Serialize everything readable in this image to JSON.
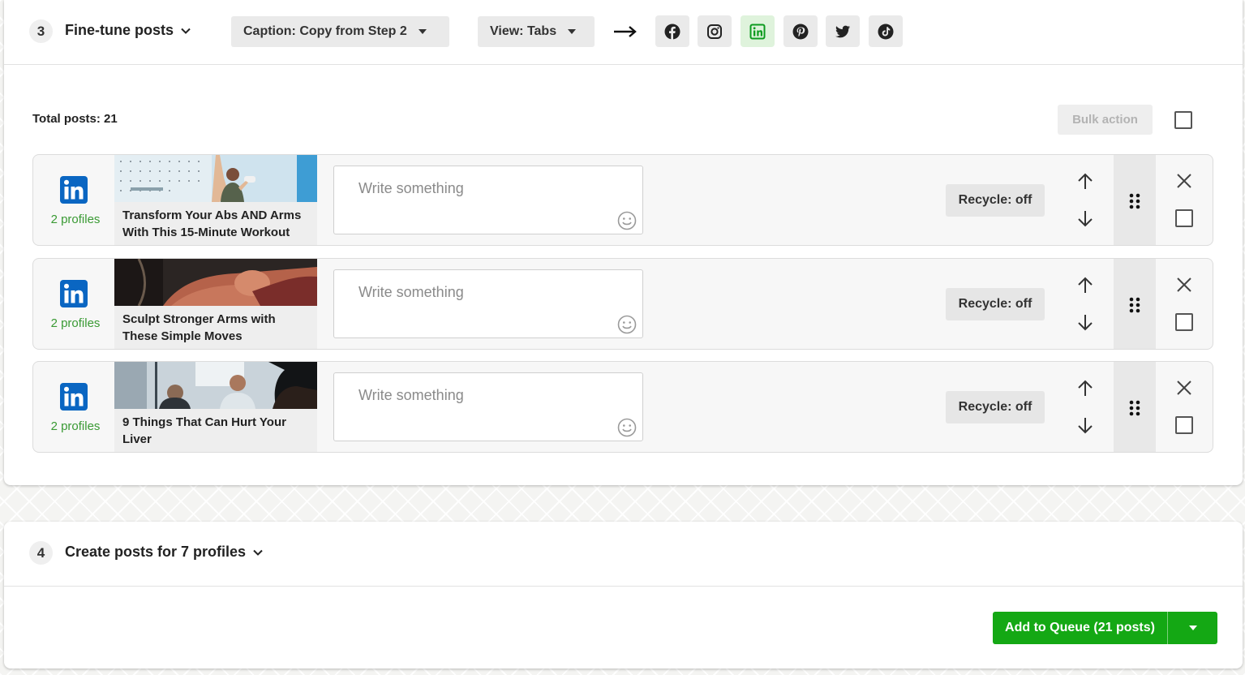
{
  "step3": {
    "number": "3",
    "title": "Fine-tune posts",
    "caption_dropdown": "Caption: Copy from Step 2",
    "view_dropdown": "View: Tabs",
    "networks": [
      "facebook-icon",
      "instagram-icon",
      "linkedin-icon",
      "pinterest-icon",
      "twitter-icon",
      "tiktok-icon"
    ],
    "active_network": "linkedin-icon",
    "total_posts": "Total posts: 21",
    "bulk_action": "Bulk action"
  },
  "posts": [
    {
      "profiles": "2 profiles",
      "title": "Transform Your Abs AND Arms With This 15-Minute Workout",
      "placeholder": "Write something",
      "recycle": "Recycle: off"
    },
    {
      "profiles": "2 profiles",
      "title": "Sculpt Stronger Arms with These Simple Moves",
      "placeholder": "Write something",
      "recycle": "Recycle: off"
    },
    {
      "profiles": "2 profiles",
      "title": "9 Things That Can Hurt Your Liver",
      "placeholder": "Write something",
      "recycle": "Recycle: off"
    }
  ],
  "step4": {
    "number": "4",
    "title": "Create posts for 7 profiles",
    "add_to_queue": "Add to Queue (21 posts)"
  },
  "colors": {
    "accent_green": "#14a814",
    "linkedin_blue": "#0a66c2",
    "profiles_green": "#3a9a34"
  }
}
